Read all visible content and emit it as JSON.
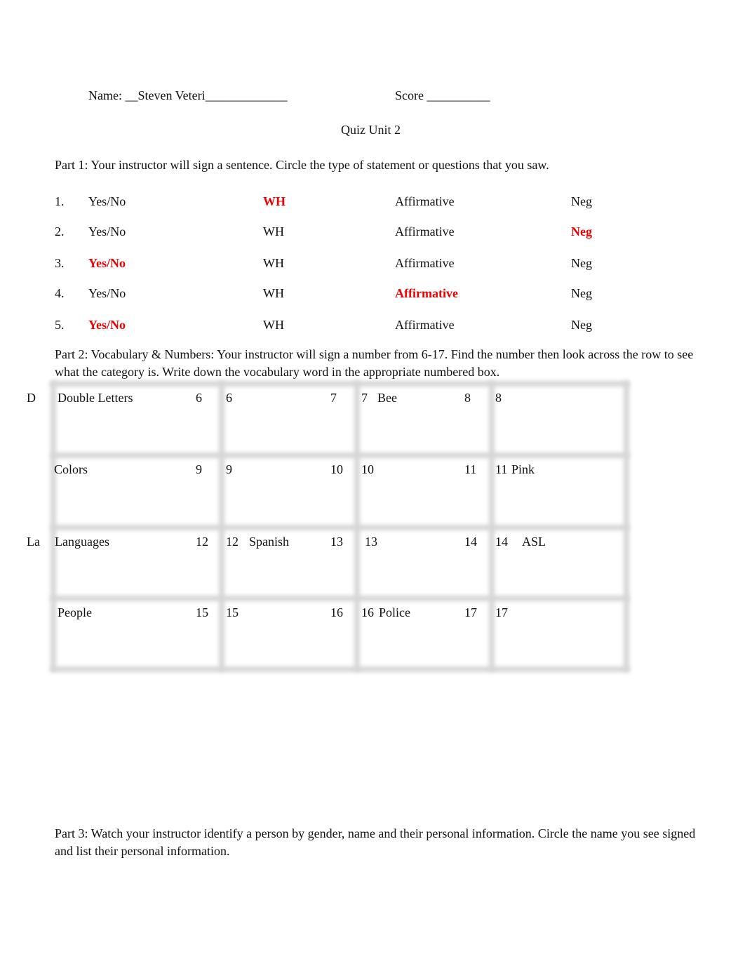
{
  "header": {
    "name_label": "Name: __Steven Veteri_____________",
    "score_label": "Score __________",
    "title": "Quiz Unit 2"
  },
  "part1": {
    "instructions": "Part 1: Your instructor will sign a sentence. Circle the type of statement or questions that you saw.",
    "options": [
      "Yes/No",
      "WH",
      "Affirmative",
      "Neg"
    ],
    "answer_color": "#ee0000",
    "items": [
      {
        "number": "1.",
        "choices": [
          "Yes/No",
          "WH",
          "Affirmative",
          "Neg"
        ],
        "selected": "WH"
      },
      {
        "number": "2.",
        "choices": [
          "Yes/No",
          "WH",
          "Affirmative",
          "Neg"
        ],
        "selected": "Neg"
      },
      {
        "number": "3.",
        "choices": [
          "Yes/No",
          "WH",
          "Affirmative",
          "Neg"
        ],
        "selected": "Yes/No"
      },
      {
        "number": "4.",
        "choices": [
          "Yes/No",
          "WH",
          "Affirmative",
          "Neg"
        ],
        "selected": "Affirmative"
      },
      {
        "number": "5.",
        "choices": [
          "Yes/No",
          "WH",
          "Affirmative",
          "Neg"
        ],
        "selected": "Yes/No"
      }
    ]
  },
  "part2": {
    "instructions": "Part 2: Vocabulary & Numbers: Your instructor will sign a number from 6-17. Find the number then look across the row to see what the category is. Write down the vocabulary word in the appropriate numbered box.",
    "rows": [
      {
        "margin_note": "D",
        "category": "Double Letters",
        "cells": [
          {
            "number": "6",
            "box_number": "6",
            "answer": ""
          },
          {
            "number": "7",
            "box_number": "7",
            "answer": "Bee"
          },
          {
            "number": "8",
            "box_number": "8",
            "answer": ""
          }
        ]
      },
      {
        "margin_note": "",
        "category": "Colors",
        "cells": [
          {
            "number": "9",
            "box_number": "9",
            "answer": ""
          },
          {
            "number": "10",
            "box_number": "10",
            "answer": ""
          },
          {
            "number": "11",
            "box_number": "11",
            "answer": "Pink"
          }
        ]
      },
      {
        "margin_note": "La",
        "category": "Languages",
        "cells": [
          {
            "number": "12",
            "box_number": "12",
            "answer": "Spanish"
          },
          {
            "number": "13",
            "box_number": "13",
            "answer": ""
          },
          {
            "number": "14",
            "box_number": "14",
            "answer": "ASL"
          }
        ]
      },
      {
        "margin_note": "",
        "category": "People",
        "cells": [
          {
            "number": "15",
            "box_number": "15",
            "answer": ""
          },
          {
            "number": "16",
            "box_number": "16",
            "answer": "Police"
          },
          {
            "number": "17",
            "box_number": "17",
            "answer": ""
          }
        ]
      }
    ]
  },
  "part3": {
    "instructions": "Part 3:  Watch your instructor identify a person by gender, name and their personal information. Circle the name you see signed and list their personal information."
  }
}
